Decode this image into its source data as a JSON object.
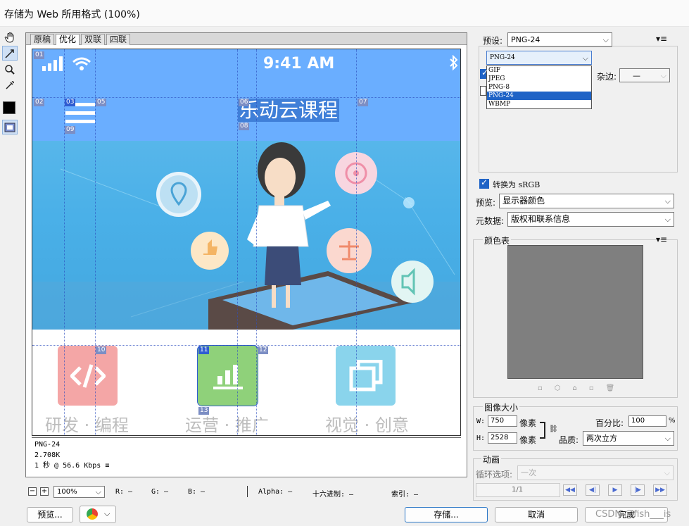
{
  "window": {
    "title": "存储为 Web 所用格式 (100%)"
  },
  "tabs": [
    "原稿",
    "优化",
    "双联",
    "四联"
  ],
  "active_tab": 1,
  "doc": {
    "status_time": "9:41 AM",
    "course_title": "乐动云课程",
    "slices": [
      "01",
      "02",
      "03",
      "05",
      "06",
      "07",
      "08",
      "09",
      "10",
      "11",
      "12",
      "13"
    ],
    "categories": [
      {
        "label": "研发 · 编程",
        "color": "#f4a6a6",
        "icon": "code-icon"
      },
      {
        "label": "运营 · 推广",
        "color": "#8fd17a",
        "icon": "bar-chart-icon"
      },
      {
        "label": "视觉 · 创意",
        "color": "#8ad4ec",
        "icon": "layers-icon"
      }
    ],
    "info": {
      "format": "PNG-24",
      "size": "2.708K",
      "speed": "1 秒 @ 56.6 Kbps"
    }
  },
  "right_panel": {
    "preset_label": "预设:",
    "preset_value": "PNG-24",
    "format_value": "PNG-24",
    "format_options": [
      "GIF",
      "JPEG",
      "PNG-8",
      "PNG-24",
      "WBMP"
    ],
    "format_selected": 3,
    "matte_label": "杂边:",
    "matte_value": "—",
    "convert_srgb": "转换为 sRGB",
    "preview_label": "预览:",
    "preview_value": "显示器颜色",
    "metadata_label": "元数据:",
    "metadata_value": "版权和联系信息",
    "color_table_label": "颜色表",
    "image_size_label": "图像大小",
    "w_label": "W:",
    "w_value": "750",
    "h_label": "H:",
    "h_value": "2528",
    "px_unit": "像素",
    "percent_label": "百分比:",
    "percent_value": "100",
    "percent_unit": "%",
    "quality_label": "品质:",
    "quality_value": "两次立方",
    "animation_label": "动画",
    "loop_label": "循环选项:",
    "loop_value": "一次",
    "frame_counter": "1/1"
  },
  "bottom_bar": {
    "zoom_value": "100%",
    "r_label": "R: —",
    "g_label": "G: —",
    "b_label": "B: —",
    "alpha_label": "Alpha: —",
    "hex_label": "十六进制: —",
    "index_label": "索引: —",
    "preview_button": "预览...",
    "save_button": "存储...",
    "cancel_button": "取消",
    "done_button": "完成",
    "watermark": "CSDN @fish___is"
  }
}
